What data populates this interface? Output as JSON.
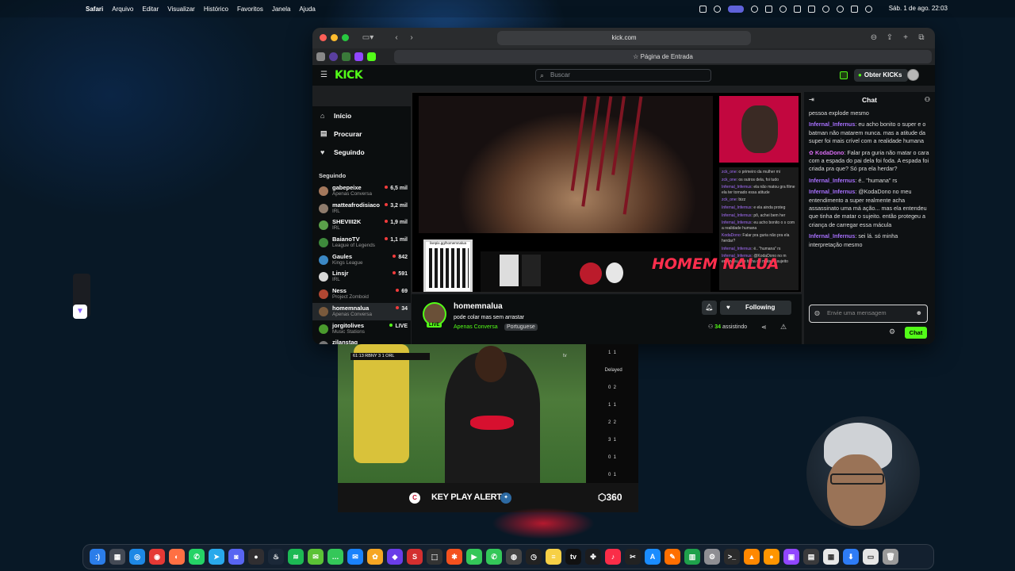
{
  "menubar": {
    "app": "Safari",
    "items": [
      "Arquivo",
      "Editar",
      "Visualizar",
      "Histórico",
      "Favoritos",
      "Janela",
      "Ajuda"
    ],
    "clock": "Sáb. 1 de ago.  22:03"
  },
  "browser": {
    "url": "kick.com",
    "tab_title": "Página de Entrada"
  },
  "kick": {
    "logo": "KICK",
    "search_placeholder": "Buscar",
    "get_kicks": "Obter KICKs",
    "nav": [
      {
        "label": "Início",
        "icon": "home-icon"
      },
      {
        "label": "Procurar",
        "icon": "browse-icon"
      },
      {
        "label": "Seguindo",
        "icon": "heart-icon"
      }
    ],
    "following_title": "Seguindo",
    "channels": [
      {
        "name": "gabepeixe",
        "category": "Apenas Conversa",
        "viewers": "6,5 mil",
        "color": "#a4785c"
      },
      {
        "name": "matteafrodisiaco",
        "category": "IRL",
        "viewers": "3,2 mil",
        "color": "#8e7b6c"
      },
      {
        "name": "SHEVIII2K",
        "category": "IRL",
        "viewers": "1,9 mil",
        "color": "#5aa04a"
      },
      {
        "name": "BaianoTV",
        "category": "League of Legends",
        "viewers": "1,1 mil",
        "color": "#3e8a3c"
      },
      {
        "name": "Gaules",
        "category": "Kings League",
        "viewers": "842",
        "color": "#3b88c4"
      },
      {
        "name": "Linsjr",
        "category": "IRL",
        "viewers": "591",
        "color": "#d8d8d8"
      },
      {
        "name": "Ness",
        "category": "Project Zomboid",
        "viewers": "69",
        "color": "#b04732"
      },
      {
        "name": "homemnalua",
        "category": "Apenas Conversa",
        "viewers": "34",
        "color": "#7a5a3c"
      },
      {
        "name": "jorgitolives",
        "category": "Music Stations",
        "viewers": "LIVE",
        "color": "#4a9a2d"
      },
      {
        "name": "zilanstag",
        "category": "",
        "viewers": "",
        "color": "#777777"
      }
    ],
    "stream": {
      "channel": "homemnalua",
      "title": "pode colar mas sem arrastar",
      "category": "Apenas Conversa",
      "language": "Portuguese",
      "live_badge": "LIVE",
      "follow_label": "Following",
      "viewers_count": "34",
      "viewers_label": "assistindo",
      "overlay_brand": "HOMEM NALUA",
      "overlay_qr_label": "livepix.gg/homemnalua"
    },
    "overlay_chat": [
      {
        "user": "zck_one",
        "text": "o primeiro da mulher mi"
      },
      {
        "user": "zck_one",
        "text": "os outros dela, foi tudo"
      },
      {
        "user": "Infernal_Infernus",
        "text": "ela não matou gra filme ela ter tornado essa atitude"
      },
      {
        "user": "zck_one",
        "text": "bizz"
      },
      {
        "user": "Infernal_Infernus",
        "text": "e ela ainda proteg"
      },
      {
        "user": "Infernal_Infernus",
        "text": "pô, achei bem her"
      },
      {
        "user": "Infernal_Infernus",
        "text": "eu acho bonito o s com a realidade humana"
      },
      {
        "user": "KodaDono",
        "text": "Falar pra guria não pra ela herdar?"
      },
      {
        "user": "Infernal_Infernus",
        "text": "é.. \"humana\" rs"
      },
      {
        "user": "Infernal_Infernus",
        "text": "@KodaDono no m entendeu que tinha de matar o sujeito"
      }
    ],
    "chat": {
      "title": "Chat",
      "messages": [
        {
          "user": "",
          "text": "pessoa explode mesmo"
        },
        {
          "user": "Infernal_Infernus",
          "text": "eu acho bonito o super e o batman não matarem nunca. mas a atitude da super foi mais crível com a realidade humana"
        },
        {
          "user": "KodaDono",
          "text": "Falar pra guria não matar o cara com a espada do pai dela foi foda. A espada foi criada pra que? Só pra ela herdar?"
        },
        {
          "user": "Infernal_Infernus",
          "text": "é.. \"humana\" rs"
        },
        {
          "user": "Infernal_Infernus",
          "text": "@KodaDono no meu entendimento a super realmente acha assassinato uma má ação... mas ela entendeu que tinha de matar o sujeito. então protegeu a criança de carregar essa mácula"
        },
        {
          "user": "Infernal_Infernus",
          "text": "sei lá. só minha interpretação mesmo"
        }
      ],
      "input_placeholder": "Envie uma mensagem",
      "send_label": "Chat"
    }
  },
  "mls": {
    "scorebug": "61:13   RBNY  3  1  ORL",
    "network": "tv",
    "banner": "KEY PLAY ALERT",
    "brand": "360",
    "scores": [
      {
        "home": "1",
        "away": "1"
      },
      {
        "home": "",
        "away": "Delayed"
      },
      {
        "home": "0",
        "away": "2"
      },
      {
        "home": "1",
        "away": "1"
      },
      {
        "home": "2",
        "away": "2"
      },
      {
        "home": "3",
        "away": "1"
      },
      {
        "home": "0",
        "away": "1"
      },
      {
        "home": "0",
        "away": "1"
      }
    ]
  },
  "dock": {
    "apps": [
      {
        "name": "finder",
        "color": "#2b7de9",
        "glyph": ":)"
      },
      {
        "name": "launchpad",
        "color": "#444a55",
        "glyph": "▦"
      },
      {
        "name": "safari",
        "color": "#1e88e5",
        "glyph": "◎"
      },
      {
        "name": "chrome",
        "color": "#e53935",
        "glyph": "◉"
      },
      {
        "name": "firefox",
        "color": "#ff7043",
        "glyph": "◐"
      },
      {
        "name": "whatsapp",
        "color": "#25d366",
        "glyph": "✆"
      },
      {
        "name": "telegram",
        "color": "#29a9eb",
        "glyph": "➤"
      },
      {
        "name": "discord",
        "color": "#5865f2",
        "glyph": "◙"
      },
      {
        "name": "obs",
        "color": "#302e31",
        "glyph": "●"
      },
      {
        "name": "steam",
        "color": "#1b2838",
        "glyph": "♨"
      },
      {
        "name": "spotify",
        "color": "#1db954",
        "glyph": "≋"
      },
      {
        "name": "messages-alt",
        "color": "#5bc236",
        "glyph": "✉"
      },
      {
        "name": "messages",
        "color": "#34c759",
        "glyph": "…"
      },
      {
        "name": "mail",
        "color": "#1a82fb",
        "glyph": "✉"
      },
      {
        "name": "photos",
        "color": "#f6a623",
        "glyph": "✿"
      },
      {
        "name": "vpn",
        "color": "#6a3de8",
        "glyph": "◆"
      },
      {
        "name": "app-red",
        "color": "#d32f2f",
        "glyph": "S"
      },
      {
        "name": "screenshot",
        "color": "#333333",
        "glyph": "⬚"
      },
      {
        "name": "paint",
        "color": "#f4511e",
        "glyph": "✱"
      },
      {
        "name": "facetime",
        "color": "#34c759",
        "glyph": "▶"
      },
      {
        "name": "phone",
        "color": "#34c759",
        "glyph": "✆"
      },
      {
        "name": "reminders",
        "color": "#444444",
        "glyph": "◍"
      },
      {
        "name": "clock",
        "color": "#222222",
        "glyph": "◷"
      },
      {
        "name": "notes",
        "color": "#f7d046",
        "glyph": "≡"
      },
      {
        "name": "tv",
        "color": "#111111",
        "glyph": "tv"
      },
      {
        "name": "apps",
        "color": "#1c1c1e",
        "glyph": "✤"
      },
      {
        "name": "music",
        "color": "#fa2d48",
        "glyph": "♪"
      },
      {
        "name": "capcut",
        "color": "#222222",
        "glyph": "✂"
      },
      {
        "name": "app-store",
        "color": "#1a8cff",
        "glyph": "A"
      },
      {
        "name": "pencil",
        "color": "#ff6f00",
        "glyph": "✎"
      },
      {
        "name": "numbers",
        "color": "#1fa14b",
        "glyph": "▥"
      },
      {
        "name": "settings",
        "color": "#8e8e93",
        "glyph": "⚙"
      },
      {
        "name": "terminal",
        "color": "#2b2b2b",
        "glyph": ">_"
      },
      {
        "name": "vlc",
        "color": "#ff8800",
        "glyph": "▲"
      },
      {
        "name": "orange",
        "color": "#ff9500",
        "glyph": "●"
      },
      {
        "name": "twitch",
        "color": "#9146ff",
        "glyph": "▣"
      },
      {
        "name": "trash-doc",
        "color": "#3a3a3c",
        "glyph": "▤"
      },
      {
        "name": "preview",
        "color": "#e8e8e8",
        "glyph": "▦"
      },
      {
        "name": "downloads",
        "color": "#2e7cf6",
        "glyph": "⬇"
      },
      {
        "name": "folder",
        "color": "#e6e6e6",
        "glyph": "▭"
      },
      {
        "name": "trash",
        "color": "#9a9a9a",
        "glyph": "🗑"
      }
    ]
  }
}
